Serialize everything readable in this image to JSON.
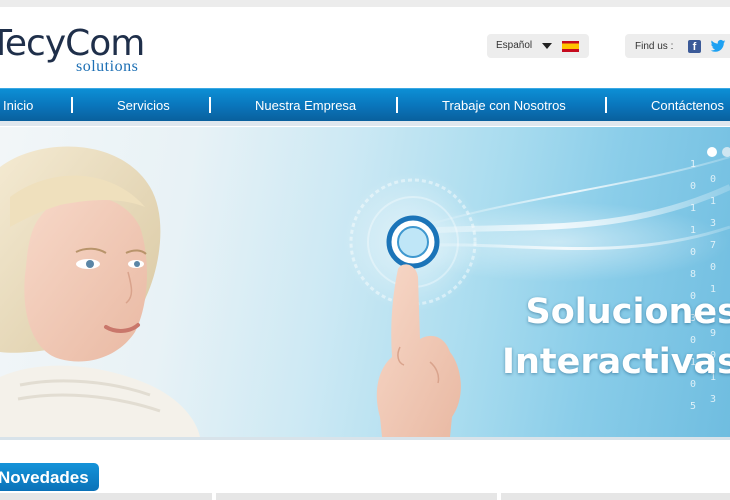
{
  "brand": {
    "name": "TecyCom",
    "tagline": "solutions"
  },
  "language": {
    "selected": "Español",
    "flag_icon": "spain-flag-icon"
  },
  "social": {
    "label": "Find us :",
    "icons": [
      "facebook-icon",
      "twitter-icon"
    ]
  },
  "nav": {
    "items": [
      {
        "label": "Inicio"
      },
      {
        "label": "Servicios"
      },
      {
        "label": "Nuestra Empresa"
      },
      {
        "label": "Trabaje con Nosotros"
      },
      {
        "label": "Contáctenos"
      }
    ]
  },
  "hero": {
    "title_line1": "Soluciones",
    "title_line2": "Interactivas",
    "slide_count": 2,
    "active_slide": 1
  },
  "news": {
    "label": "Novedades"
  },
  "colors": {
    "nav_blue": "#0a74ba",
    "logo_dark": "#1f2f4a",
    "logo_blue": "#1c6fb4"
  }
}
